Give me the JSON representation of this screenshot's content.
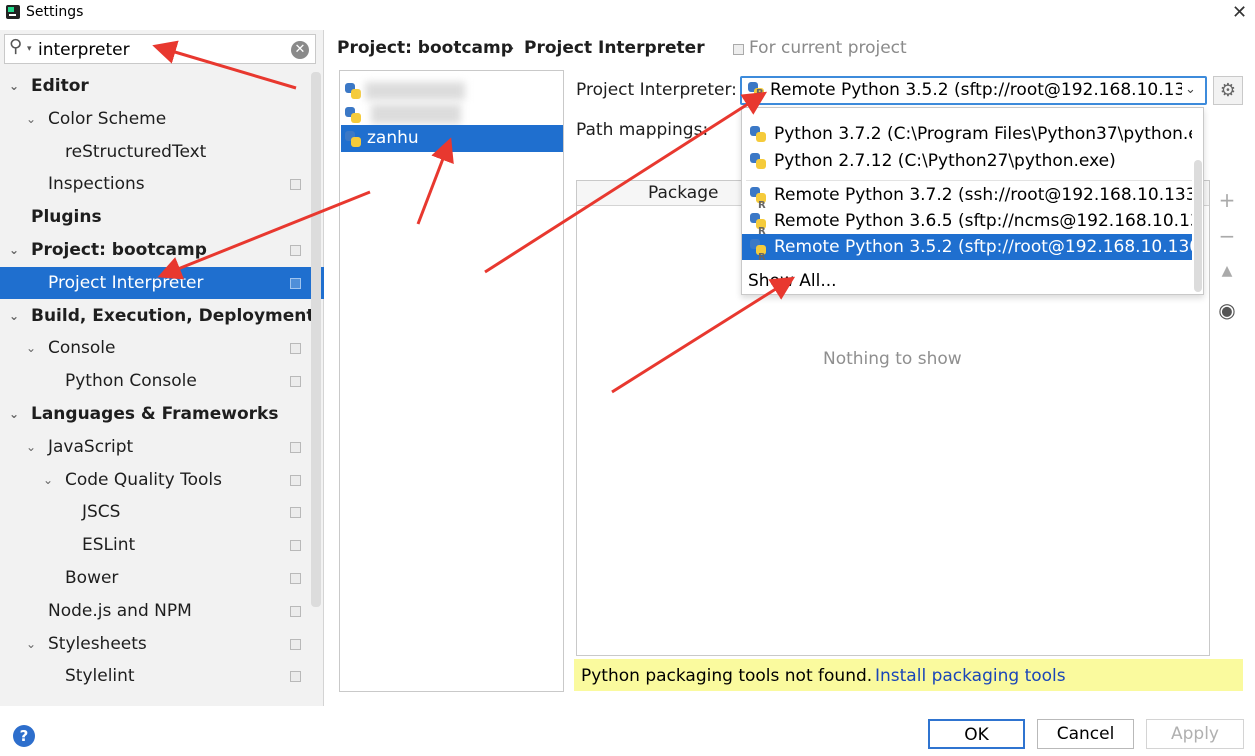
{
  "window": {
    "title": "Settings"
  },
  "search": {
    "value": "interpreter"
  },
  "tree": [
    {
      "label": "Editor",
      "bold": true,
      "level": 0,
      "arrow": true,
      "copy": false
    },
    {
      "label": "Color Scheme",
      "bold": false,
      "level": 1,
      "arrow": true,
      "copy": false
    },
    {
      "label": "reStructuredText",
      "bold": false,
      "level": 2,
      "arrow": false,
      "copy": false
    },
    {
      "label": "Inspections",
      "bold": false,
      "level": 1,
      "arrow": false,
      "copy": true
    },
    {
      "label": "Plugins",
      "bold": true,
      "level": 0,
      "arrow": false,
      "copy": false
    },
    {
      "label": "Project: bootcamp",
      "bold": true,
      "level": 0,
      "arrow": true,
      "copy": true
    },
    {
      "label": "Project Interpreter",
      "bold": false,
      "level": 1,
      "arrow": false,
      "copy": true,
      "selected": true
    },
    {
      "label": "Build, Execution, Deployment",
      "bold": true,
      "level": 0,
      "arrow": true,
      "copy": false
    },
    {
      "label": "Console",
      "bold": false,
      "level": 1,
      "arrow": true,
      "copy": true
    },
    {
      "label": "Python Console",
      "bold": false,
      "level": 2,
      "arrow": false,
      "copy": true
    },
    {
      "label": "Languages & Frameworks",
      "bold": true,
      "level": 0,
      "arrow": true,
      "copy": false
    },
    {
      "label": "JavaScript",
      "bold": false,
      "level": 1,
      "arrow": true,
      "copy": true
    },
    {
      "label": "Code Quality Tools",
      "bold": false,
      "level": 2,
      "arrow": true,
      "copy": true
    },
    {
      "label": "JSCS",
      "bold": false,
      "level": 3,
      "arrow": false,
      "copy": true
    },
    {
      "label": "ESLint",
      "bold": false,
      "level": 3,
      "arrow": false,
      "copy": true
    },
    {
      "label": "Bower",
      "bold": false,
      "level": 2,
      "arrow": false,
      "copy": true
    },
    {
      "label": "Node.js and NPM",
      "bold": false,
      "level": 1,
      "arrow": false,
      "copy": true
    },
    {
      "label": "Stylesheets",
      "bold": false,
      "level": 1,
      "arrow": true,
      "copy": true
    },
    {
      "label": "Stylelint",
      "bold": false,
      "level": 2,
      "arrow": false,
      "copy": true
    }
  ],
  "projects": {
    "selected": "zanhu"
  },
  "breadcrumb": {
    "parent": "Project: bootcamp",
    "separator": "›",
    "current": "Project Interpreter"
  },
  "for_current_project": "For current project",
  "interpreter": {
    "label": "Project Interpreter:",
    "selected": "Remote Python 3.5.2 (sftp://root@192.168.10.13",
    "path_mappings_label": "Path mappings:"
  },
  "dropdown": {
    "items": [
      {
        "text": "Python 3.7.2 (C:\\Program Files\\Python37\\python.e",
        "remote": false
      },
      {
        "text": "Python 2.7.12 (C:\\Python27\\python.exe)",
        "remote": false
      },
      {
        "text": "Remote Python 3.7.2 (ssh://root@192.168.10.133:",
        "remote": true
      },
      {
        "text": "Remote Python 3.6.5 (sftp://ncms@192.168.10.13",
        "remote": true
      },
      {
        "text": "Remote Python 3.5.2 (sftp://root@192.168.10.130",
        "remote": true,
        "selected": true
      }
    ],
    "show_all": "Show All..."
  },
  "packages": {
    "column": "Package",
    "empty": "Nothing to show"
  },
  "warning": {
    "text": "Python packaging tools not found.",
    "link": "Install packaging tools"
  },
  "buttons": {
    "ok": "OK",
    "cancel": "Cancel",
    "apply": "Apply",
    "help": "?"
  },
  "colors": {
    "selection": "#1f6fcf",
    "annotation": "#e8382f",
    "warning_bg": "#fafa9e",
    "link": "#1a46b8"
  }
}
